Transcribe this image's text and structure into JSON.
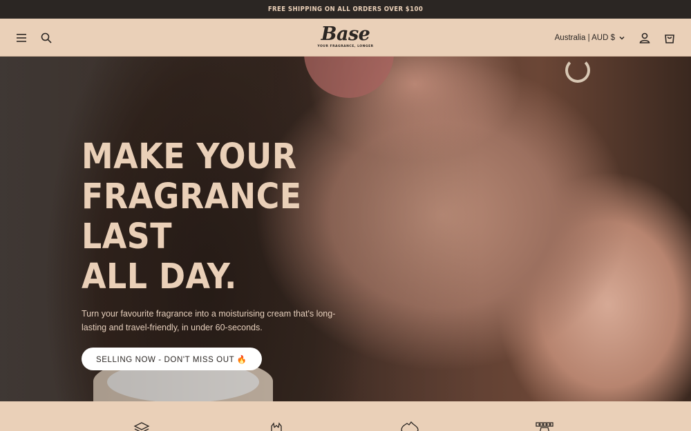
{
  "announcement": {
    "text": "FREE SHIPPING ON ALL ORDERS OVER $100"
  },
  "header": {
    "logo_text": "Base",
    "logo_tagline": "YOUR FRAGRANCE, LONGER",
    "locale_label": "Australia | AUD $",
    "icons": [
      "menu-icon",
      "search-icon",
      "account-icon",
      "cart-icon"
    ]
  },
  "hero": {
    "title_line1": "MAKE YOUR",
    "title_line2": "FRAGRANCE LAST",
    "title_line3": "ALL DAY.",
    "subtitle": "Turn your favourite fragrance into a moisturising cream that's long-lasting and travel-friendly, in under 60-seconds.",
    "cta_label": "SELLING NOW - DON'T MISS OUT 🔥"
  },
  "features": {
    "icons": [
      "layers-icon",
      "hands-icon",
      "australia-map-icon",
      "packaging-icon"
    ]
  },
  "colors": {
    "accent": "#ead0b8",
    "dark": "#2b2623",
    "button": "#ffffff"
  }
}
